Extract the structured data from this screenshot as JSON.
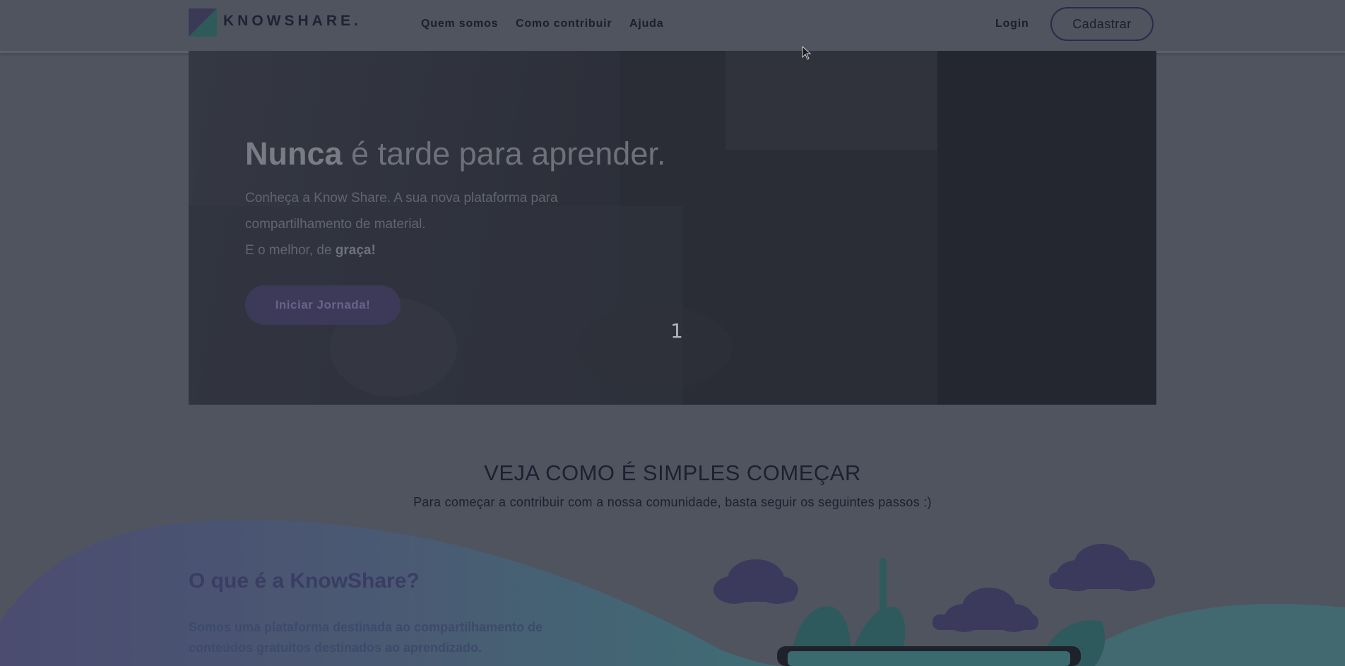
{
  "header": {
    "logo_text": "KNOWSHARE.",
    "nav": [
      "Quem somos",
      "Como contribuir",
      "Ajuda"
    ],
    "login_label": "Login",
    "signup_label": "Cadastrar"
  },
  "hero": {
    "title_strong": "Nunca",
    "title_rest": " é tarde para aprender.",
    "text_line1": "Conheça a Know Share. A sua nova plataforma para compartilhamento de material.",
    "text_line2_prefix": "E o melhor, de ",
    "text_line2_strong": "graça!",
    "cta_label": "Iniciar Jornada!",
    "slide_number": "1"
  },
  "steps": {
    "title": "VEJA COMO É SIMPLES COMEÇAR",
    "subtitle": "Para começar a contribuir com a nossa comunidade, basta seguir os seguintes passos :)"
  },
  "about": {
    "title": "O que é a KnowShare?",
    "text": "Somos uma plataforma destinada ao compartilhamento de conteúdos gratuitos destinados ao aprendizado."
  },
  "colors": {
    "accent": "#3c3a58",
    "overlay": "#50545f",
    "teal": "#3a6f73"
  },
  "icons": [
    "logo-mark",
    "mouse-cursor-icon"
  ]
}
